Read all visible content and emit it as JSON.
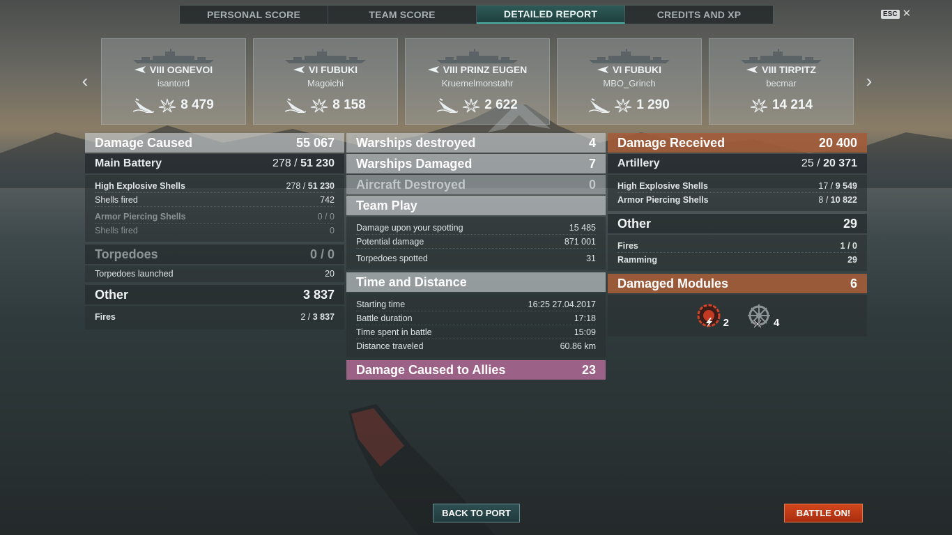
{
  "tabs": [
    {
      "label": "PERSONAL SCORE",
      "active": false
    },
    {
      "label": "TEAM SCORE",
      "active": false
    },
    {
      "label": "DETAILED REPORT",
      "active": true
    },
    {
      "label": "CREDITS AND XP",
      "active": false
    }
  ],
  "esc": {
    "badge": "ESC",
    "icon": "close-icon"
  },
  "cards": [
    {
      "ship": "VIII OGNEVOI",
      "player": "isantord",
      "damage": "8 479",
      "destroyed": true,
      "type_icon": "destroyer-icon"
    },
    {
      "ship": "VI FUBUKI",
      "player": "Magoichi",
      "damage": "8 158",
      "destroyed": true,
      "type_icon": "destroyer-icon"
    },
    {
      "ship": "VIII PRINZ EUGEN",
      "player": "Kruemelmonstahr",
      "damage": "2 622",
      "destroyed": true,
      "type_icon": "cruiser-icon"
    },
    {
      "ship": "VI FUBUKI",
      "player": "MBO_Grinch",
      "damage": "1 290",
      "destroyed": true,
      "type_icon": "destroyer-icon"
    },
    {
      "ship": "VIII TIRPITZ",
      "player": "becmar",
      "damage": "14 214",
      "destroyed": false,
      "type_icon": "battleship-icon"
    }
  ],
  "left": {
    "damage_caused": {
      "label": "Damage Caused",
      "value": "55 067"
    },
    "main_battery": {
      "label": "Main Battery",
      "value_a": "278 / ",
      "value_b": "51 230"
    },
    "he": {
      "label": "High Explosive Shells",
      "value_a": "278 / ",
      "value_b": "51 230"
    },
    "he_fired": {
      "label": "Shells fired",
      "value": "742"
    },
    "ap": {
      "label": "Armor Piercing Shells",
      "value": "0 / 0"
    },
    "ap_fired": {
      "label": "Shells fired",
      "value": "0"
    },
    "torpedoes": {
      "label": "Torpedoes",
      "value": "0 / 0"
    },
    "torp_launched": {
      "label": "Torpedoes launched",
      "value": "20"
    },
    "other": {
      "label": "Other",
      "value": "3 837"
    },
    "fires": {
      "label": "Fires",
      "value_a": "2 / ",
      "value_b": "3 837"
    }
  },
  "middle": {
    "destroyed": {
      "label": "Warships destroyed",
      "value": "4"
    },
    "damaged": {
      "label": "Warships Damaged",
      "value": "7"
    },
    "aircraft": {
      "label": "Aircraft Destroyed",
      "value": "0"
    },
    "team_play": {
      "label": "Team Play"
    },
    "spotting": {
      "label": "Damage upon your spotting",
      "value": "15 485"
    },
    "potential": {
      "label": "Potential damage",
      "value": "871 001"
    },
    "torp_spotted": {
      "label": "Torpedoes spotted",
      "value": "31"
    },
    "time_distance": {
      "label": "Time and Distance"
    },
    "start": {
      "label": "Starting time",
      "value": "16:25  27.04.2017"
    },
    "duration": {
      "label": "Battle duration",
      "value": "17:18"
    },
    "time_spent": {
      "label": "Time spent in battle",
      "value": "15:09"
    },
    "distance": {
      "label": "Distance traveled",
      "value": "60.86 km"
    },
    "allies": {
      "label": "Damage Caused to Allies",
      "value": "23"
    }
  },
  "right": {
    "received": {
      "label": "Damage Received",
      "value": "20 400"
    },
    "artillery": {
      "label": "Artillery",
      "value_a": "25 / ",
      "value_b": "20 371"
    },
    "he": {
      "label": "High Explosive Shells",
      "value_a": "17 / ",
      "value_b": "9 549"
    },
    "ap": {
      "label": "Armor Piercing Shells",
      "value_a": "8 / ",
      "value_b": "10 822"
    },
    "other": {
      "label": "Other",
      "value": "29"
    },
    "fires": {
      "label": "Fires",
      "value": "1 / 0"
    },
    "ramming": {
      "label": "Ramming",
      "value": "29"
    },
    "modules": {
      "label": "Damaged Modules",
      "value": "6"
    },
    "module_counts": {
      "engine": "2",
      "steering": "4"
    }
  },
  "buttons": {
    "back": "BACK TO PORT",
    "battle": "BATTLE ON!"
  },
  "colors": {
    "accent_teal": "#4cb0a2",
    "received_orange": "#a25c3a",
    "allies_pink": "#af6894",
    "battle_red": "#d2471c"
  }
}
